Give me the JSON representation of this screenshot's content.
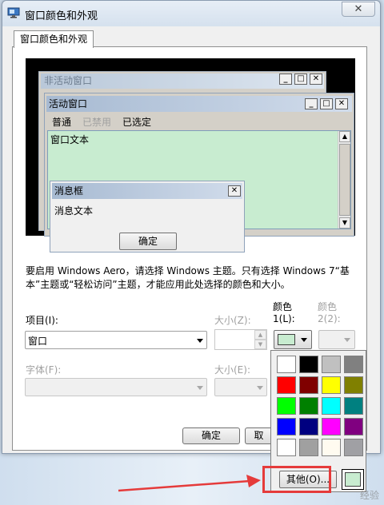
{
  "window": {
    "title": "窗口颜色和外观",
    "close": "✕"
  },
  "tab": {
    "label": "窗口颜色和外观"
  },
  "preview": {
    "inactive_title": "非活动窗口",
    "active_title": "活动窗口",
    "menu": {
      "normal": "普通",
      "disabled": "已禁用",
      "selected": "已选定"
    },
    "window_text": "窗口文本",
    "msgbox_title": "消息框",
    "msgbox_text": "消息文本",
    "msgbox_ok": "确定",
    "cap_min": "_",
    "cap_max": "□",
    "cap_close": "✕"
  },
  "description": "要启用 Windows Aero，请选择 Windows 主题。只有选择 Windows 7“基本”主题或“轻松访问”主题，才能应用此处选择的颜色和大小。",
  "fields": {
    "item_label": "项目(I):",
    "item_value": "窗口",
    "size_label": "大小(Z):",
    "color1_label_a": "颜色",
    "color1_label_b": "1(L):",
    "color2_label_a": "颜色",
    "color2_label_b": "2(2):",
    "font_label": "字体(F):",
    "size2_label": "大小(E):"
  },
  "buttons": {
    "ok": "确定",
    "cancel": "取"
  },
  "palette": {
    "colors": [
      "#ffffff",
      "#000000",
      "#c0c0c0",
      "#808080",
      "#ff0000",
      "#800000",
      "#ffff00",
      "#808000",
      "#00ff00",
      "#008000",
      "#00ffff",
      "#008080",
      "#0000ff",
      "#000080",
      "#ff00ff",
      "#800080",
      "#ffffff",
      "#a0a0a0",
      "#fffbf0",
      "#a0a0a4"
    ],
    "other_button": "其他(O)...",
    "current_color": "#c8ecd0"
  },
  "watermark": "经验"
}
